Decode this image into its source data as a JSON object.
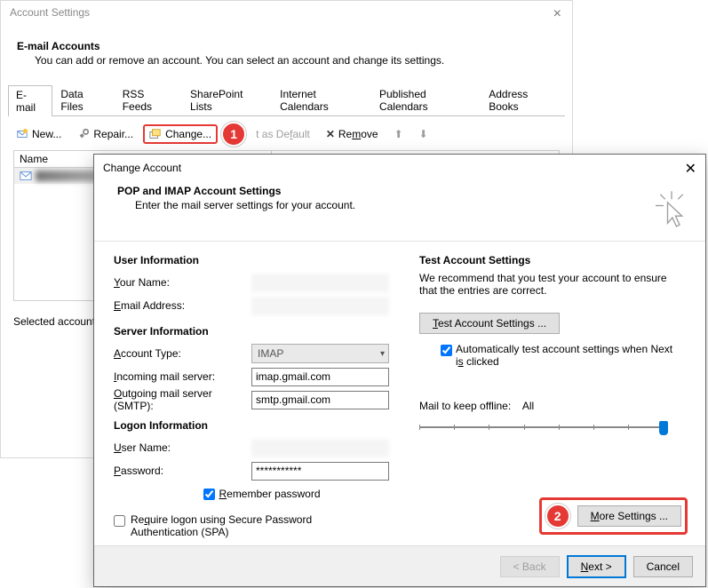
{
  "win1": {
    "title": "Account Settings",
    "heading": "E-mail Accounts",
    "description": "You can add or remove an account. You can select an account and change its settings.",
    "tabs": [
      "E-mail",
      "Data Files",
      "RSS Feeds",
      "SharePoint Lists",
      "Internet Calendars",
      "Published Calendars",
      "Address Books"
    ],
    "toolbar": {
      "new": "New...",
      "repair": "Repair...",
      "change": "Change...",
      "set_default": "Set as Default",
      "remove": "Remove"
    },
    "list_header_name": "Name",
    "selected_prefix": "Selected account de"
  },
  "marker1": "1",
  "marker2": "2",
  "win2": {
    "title": "Change Account",
    "header_title": "POP and IMAP Account Settings",
    "header_desc": "Enter the mail server settings for your account.",
    "user_info_h": "User Information",
    "your_name_l": "Your Name:",
    "email_l": "Email Address:",
    "server_info_h": "Server Information",
    "account_type_l": "Account Type:",
    "account_type_v": "IMAP",
    "incoming_l": "Incoming mail server:",
    "incoming_v": "imap.gmail.com",
    "outgoing_l": "Outgoing mail server (SMTP):",
    "outgoing_v": "smtp.gmail.com",
    "logon_h": "Logon Information",
    "user_name_l": "User Name:",
    "password_l": "Password:",
    "password_v": "***********",
    "remember_l": "Remember password",
    "spa_l": "Require logon using Secure Password Authentication (SPA)",
    "test_h": "Test Account Settings",
    "test_desc": "We recommend that you test your account to ensure that the entries are correct.",
    "test_btn": "Test Account Settings ...",
    "auto_test_l": "Automatically test account settings when Next is clicked",
    "mail_offline_l": "Mail to keep offline:",
    "mail_offline_v": "All",
    "more_settings": "More Settings ...",
    "back": "< Back",
    "next": "Next >",
    "cancel": "Cancel"
  }
}
